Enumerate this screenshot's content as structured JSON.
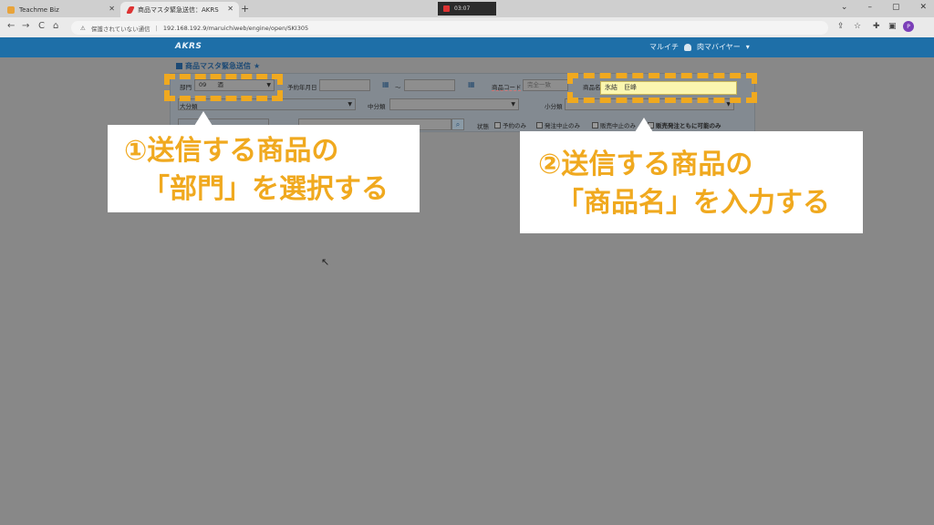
{
  "browser": {
    "tabs": [
      {
        "title": "Teachme Biz"
      },
      {
        "title": "商品マスタ緊急送信：AKRS"
      }
    ],
    "new_tab": "+",
    "recording": "03:07",
    "window_controls": [
      "⌄",
      "–",
      "▢",
      "✕"
    ],
    "nav": {
      "back": "←",
      "forward": "→",
      "reload": "C",
      "home": "⌂"
    },
    "security_label": "保護されていない通信",
    "url": "192.168.192.9/maruichiweb/engine/open/SKI305",
    "profile_initial": "P"
  },
  "app": {
    "logo": "AKRS",
    "user_name": "マルイチ",
    "user_role": "肉マバイヤー",
    "page_title": "商品マスタ緊急送信"
  },
  "form": {
    "department": {
      "label": "部門",
      "code": "09",
      "name": "酒"
    },
    "reservation_date": {
      "label": "予約年月日",
      "tilde": "～"
    },
    "product_code": {
      "label": "商品コード",
      "placeholder": "完全一致"
    },
    "product_name": {
      "label": "商品名",
      "value": "氷結　巨峰"
    },
    "major_category": {
      "label": "大分類"
    },
    "middle_category": {
      "label": "中分類"
    },
    "minor_category": {
      "label": "小分類"
    },
    "status": {
      "label": "状態",
      "options": [
        "予約のみ",
        "発注中止のみ",
        "販売中止のみ",
        "販売発注ともに可能のみ"
      ]
    }
  },
  "callouts": {
    "step1_line1": "①送信する商品の",
    "step1_line2": "「部門」を選択する",
    "step2_line1": "②送信する商品の",
    "step2_line2": "「商品名」を入力する"
  },
  "colors": {
    "highlight": "#f0a91f",
    "header": "#1e6fa8"
  }
}
